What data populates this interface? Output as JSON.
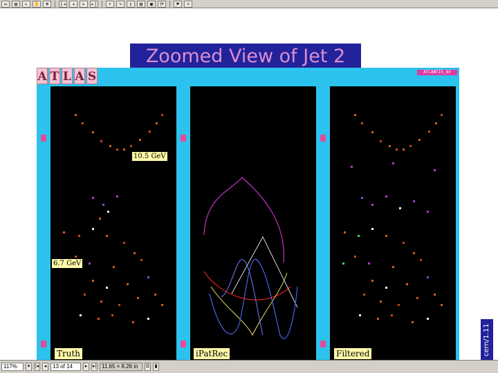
{
  "toolbar": {
    "buttons": [
      {
        "icon": "page-icon"
      },
      {
        "icon": "open-icon"
      },
      {
        "icon": "select-arrow-icon"
      },
      {
        "icon": "hand-icon"
      },
      {
        "icon": "zoom-icon"
      },
      {
        "icon": "first-page-icon"
      },
      {
        "icon": "prev-page-icon"
      },
      {
        "icon": "next-page-icon"
      },
      {
        "icon": "last-page-icon"
      },
      {
        "icon": "back-icon"
      },
      {
        "icon": "forward-icon"
      },
      {
        "icon": "single-page-icon"
      },
      {
        "icon": "continuous-icon"
      },
      {
        "icon": "facing-icon"
      },
      {
        "icon": "rotate-icon"
      },
      {
        "icon": "bookmark-icon"
      },
      {
        "icon": "find-icon"
      }
    ]
  },
  "slide": {
    "title": "Zoomed View of Jet 2",
    "atlas_letters": [
      "A",
      "T",
      "L",
      "A",
      "S"
    ],
    "atlantis_tag": "ATLANTIS_AV",
    "energy_label_1": "10.5 GeV",
    "energy_label_2": "6.7 GeV",
    "panels": {
      "truth": "Truth",
      "ipatrec": "iPatRec",
      "filtered": "Filtered"
    },
    "side_tag": "cern/1.11"
  },
  "statusbar": {
    "zoom": "117%",
    "page": "13 of 14",
    "size": "11.65 × 8.26 in"
  },
  "colors": {
    "frame": "#2cc2ee",
    "title_bg": "#22229b",
    "title_text": "#d98fd0",
    "label_bg": "#fff9a8"
  }
}
